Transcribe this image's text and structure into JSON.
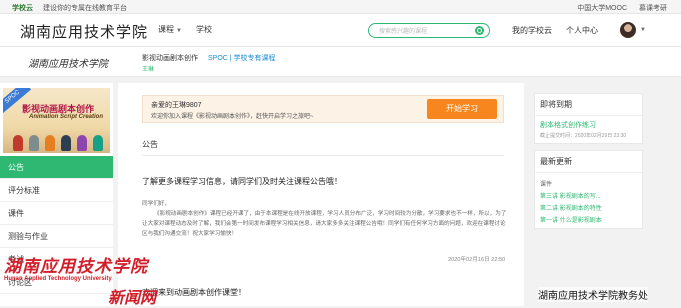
{
  "topbar": {
    "logo": "学校云",
    "notice": "建设你的专属在线教育平台",
    "links": [
      "中国大学MOOC",
      "慕课考研"
    ]
  },
  "header": {
    "brand": "湖南应用技术学院",
    "nav": [
      {
        "label": "课程",
        "has_dropdown": true
      },
      {
        "label": "学校",
        "has_dropdown": false
      }
    ],
    "search_placeholder": "搜索感兴趣的课程",
    "right_links": [
      "我的学校云",
      "个人中心"
    ]
  },
  "course": {
    "school_logo_text": "湖南应用技术学院",
    "title": "影视动画剧本创作",
    "tag": "SPOC | 学校专有课程",
    "teacher": "王琳"
  },
  "cover": {
    "badge": "SPOC",
    "title": "影视动画剧本创作",
    "subtitle": "Animation Script Creation"
  },
  "sidebar": {
    "items": [
      "公告",
      "评分标准",
      "课件",
      "测验与作业",
      "考试",
      "讨论区"
    ]
  },
  "welcome": {
    "greeting": "亲爱的王琳9807",
    "message": "欢迎你加入课程《影视动画剧本创作》，赶快开启学习之旅吧~",
    "start_button": "开始学习"
  },
  "announcement": {
    "section_title": "公告",
    "title": "了解更多课程学习信息，请同学们及时关注课程公告哦！",
    "salutation": "同学们好，",
    "body": "《影视动画剧本创作》课程已经开课了，由于本课程是在线开放课程，学习人员分布广泛，学习时间较为分散，学习要求也不一样，所以，为了让大家对课程动态及时了解，我们会第一时间发布课程学习相关信息，请大家多多关注课程公告哦！同学们有任何学习方面的问题，欢迎在课程讨论区与我们沟通交流！祝大家学习愉快！",
    "date": "2020年02月16日 22:50",
    "second_title": "欢迎来到动画剧本创作课堂！"
  },
  "right": {
    "due": {
      "heading": "即将到期",
      "item": "剧本格式创作练习",
      "deadline": "截止提交时间：2020年02月29日 23:30"
    },
    "updates": {
      "heading": "最新更新",
      "category": "课件",
      "rows": [
        {
          "chapter": "第三讲",
          "title": "影视剧本的写..."
        },
        {
          "chapter": "第二讲",
          "title": "影视剧本的特性"
        },
        {
          "chapter": "第一讲",
          "title": "什么是影视剧本"
        }
      ]
    }
  },
  "overlay": {
    "watermark_cn": "湖南应用技术学院",
    "watermark_en": "Hunan Applied Technology University",
    "news": "新闻网",
    "footer": "湖南应用技术学院教务处"
  },
  "colors": {
    "accent_green": "#2eb872",
    "start_orange": "#f7861e",
    "watermark_red": "#d21e2a"
  }
}
